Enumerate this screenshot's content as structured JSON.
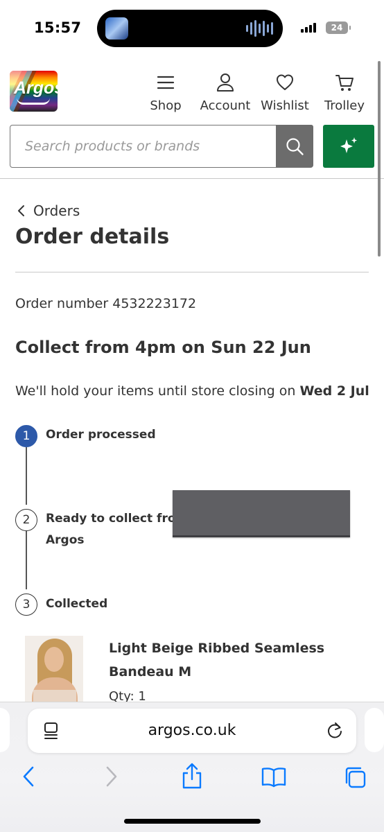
{
  "status_bar": {
    "time": "15:57",
    "battery_level": "24"
  },
  "header": {
    "logo_text": "Argos",
    "nav": {
      "shop": "Shop",
      "account": "Account",
      "wishlist": "Wishlist",
      "trolley": "Trolley"
    },
    "search_placeholder": "Search products or brands",
    "colors": {
      "search_button": "#6c6c6c",
      "ai_button": "#0a7a3e"
    }
  },
  "order": {
    "back_label": "Orders",
    "title": "Order details",
    "order_number_text": "Order number 4532223172",
    "collect_heading": "Collect from 4pm on Sun 22 Jun",
    "hold_text": "We'll hold your items until store closing on ",
    "hold_date": "Wed 2 Jul",
    "steps": [
      {
        "number": "1",
        "label": "Order processed",
        "active": true
      },
      {
        "number": "2",
        "label_line1": "Ready to collect from",
        "label_line2": "Argos",
        "active": false
      },
      {
        "number": "3",
        "label": "Collected",
        "active": false
      }
    ],
    "step_active_color": "#2d59a9",
    "product": {
      "title_line1": "Light Beige Ribbed Seamless",
      "title_line2": "Bandeau M",
      "qty": "Qty: 1"
    }
  },
  "browser": {
    "url": "argos.co.uk",
    "icons": [
      "reader-icon",
      "reload-icon",
      "back-icon",
      "forward-icon",
      "share-icon",
      "bookmarks-icon",
      "tabs-icon"
    ],
    "accent": "#0a7aff"
  }
}
